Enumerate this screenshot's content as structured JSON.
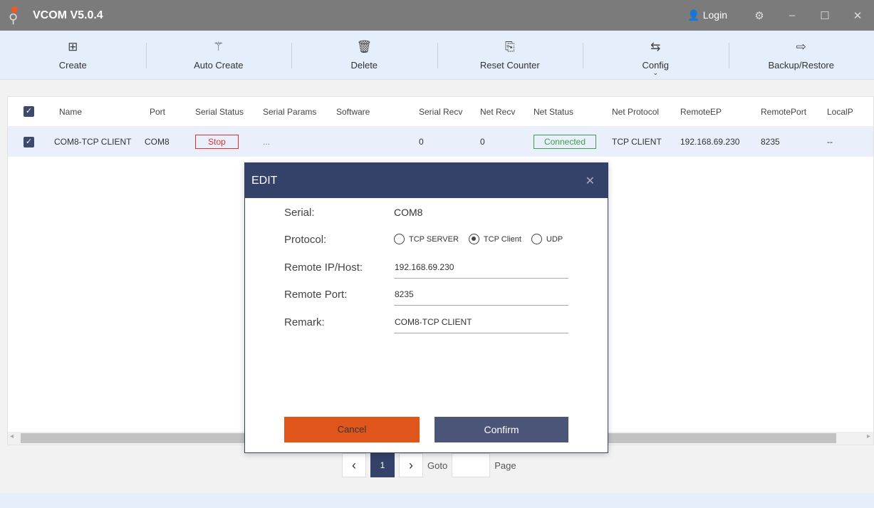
{
  "app": {
    "title": "VCOM V5.0.4",
    "login": "Login"
  },
  "toolbar": [
    {
      "label": "Create",
      "icon": "⊞"
    },
    {
      "label": "Auto Create",
      "icon": "⚚"
    },
    {
      "label": "Delete",
      "icon": "🗑"
    },
    {
      "label": "Reset Counter",
      "icon": "⎘"
    },
    {
      "label": "Config",
      "icon": "⇆",
      "chevron": "⌄"
    },
    {
      "label": "Backup/Restore",
      "icon": "⇨"
    }
  ],
  "table": {
    "headers": [
      "Name",
      "Port",
      "Serial Status",
      "Serial Params",
      "Software",
      "Serial Recv",
      "Net Recv",
      "Net Status",
      "Net Protocol",
      "RemoteEP",
      "RemotePort",
      "LocalP"
    ],
    "rows": [
      [
        "COM8-TCP CLIENT",
        "COM8",
        "Stop",
        "...",
        "",
        "0",
        "0",
        "Connected",
        "TCP CLIENT",
        "192.168.69.230",
        "8235",
        "--"
      ]
    ]
  },
  "pager": {
    "page": "1",
    "goto": "Goto",
    "page_label": "Page"
  },
  "dialog": {
    "title": "EDIT",
    "serial_label": "Serial:",
    "serial_value": "COM8",
    "protocol_label": "Protocol:",
    "protocols": [
      "TCP SERVER",
      "TCP Client",
      "UDP"
    ],
    "selected_protocol": "TCP Client",
    "remote_ip_label": "Remote IP/Host:",
    "remote_ip": "192.168.69.230",
    "remote_port_label": "Remote Port:",
    "remote_port": "8235",
    "remark_label": "Remark:",
    "remark": "COM8-TCP CLIENT",
    "cancel": "Cancel",
    "confirm": "Confirm"
  }
}
